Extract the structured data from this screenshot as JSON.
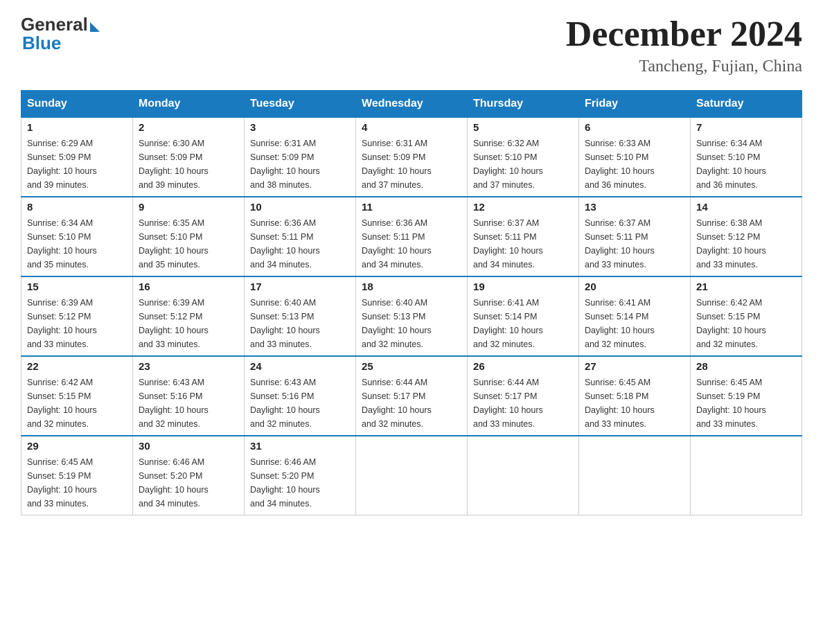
{
  "logo": {
    "general": "General",
    "blue": "Blue"
  },
  "header": {
    "month": "December 2024",
    "location": "Tancheng, Fujian, China"
  },
  "weekdays": [
    "Sunday",
    "Monday",
    "Tuesday",
    "Wednesday",
    "Thursday",
    "Friday",
    "Saturday"
  ],
  "weeks": [
    [
      {
        "day": "1",
        "sunrise": "6:29 AM",
        "sunset": "5:09 PM",
        "daylight": "10 hours and 39 minutes."
      },
      {
        "day": "2",
        "sunrise": "6:30 AM",
        "sunset": "5:09 PM",
        "daylight": "10 hours and 39 minutes."
      },
      {
        "day": "3",
        "sunrise": "6:31 AM",
        "sunset": "5:09 PM",
        "daylight": "10 hours and 38 minutes."
      },
      {
        "day": "4",
        "sunrise": "6:31 AM",
        "sunset": "5:09 PM",
        "daylight": "10 hours and 37 minutes."
      },
      {
        "day": "5",
        "sunrise": "6:32 AM",
        "sunset": "5:10 PM",
        "daylight": "10 hours and 37 minutes."
      },
      {
        "day": "6",
        "sunrise": "6:33 AM",
        "sunset": "5:10 PM",
        "daylight": "10 hours and 36 minutes."
      },
      {
        "day": "7",
        "sunrise": "6:34 AM",
        "sunset": "5:10 PM",
        "daylight": "10 hours and 36 minutes."
      }
    ],
    [
      {
        "day": "8",
        "sunrise": "6:34 AM",
        "sunset": "5:10 PM",
        "daylight": "10 hours and 35 minutes."
      },
      {
        "day": "9",
        "sunrise": "6:35 AM",
        "sunset": "5:10 PM",
        "daylight": "10 hours and 35 minutes."
      },
      {
        "day": "10",
        "sunrise": "6:36 AM",
        "sunset": "5:11 PM",
        "daylight": "10 hours and 34 minutes."
      },
      {
        "day": "11",
        "sunrise": "6:36 AM",
        "sunset": "5:11 PM",
        "daylight": "10 hours and 34 minutes."
      },
      {
        "day": "12",
        "sunrise": "6:37 AM",
        "sunset": "5:11 PM",
        "daylight": "10 hours and 34 minutes."
      },
      {
        "day": "13",
        "sunrise": "6:37 AM",
        "sunset": "5:11 PM",
        "daylight": "10 hours and 33 minutes."
      },
      {
        "day": "14",
        "sunrise": "6:38 AM",
        "sunset": "5:12 PM",
        "daylight": "10 hours and 33 minutes."
      }
    ],
    [
      {
        "day": "15",
        "sunrise": "6:39 AM",
        "sunset": "5:12 PM",
        "daylight": "10 hours and 33 minutes."
      },
      {
        "day": "16",
        "sunrise": "6:39 AM",
        "sunset": "5:12 PM",
        "daylight": "10 hours and 33 minutes."
      },
      {
        "day": "17",
        "sunrise": "6:40 AM",
        "sunset": "5:13 PM",
        "daylight": "10 hours and 33 minutes."
      },
      {
        "day": "18",
        "sunrise": "6:40 AM",
        "sunset": "5:13 PM",
        "daylight": "10 hours and 32 minutes."
      },
      {
        "day": "19",
        "sunrise": "6:41 AM",
        "sunset": "5:14 PM",
        "daylight": "10 hours and 32 minutes."
      },
      {
        "day": "20",
        "sunrise": "6:41 AM",
        "sunset": "5:14 PM",
        "daylight": "10 hours and 32 minutes."
      },
      {
        "day": "21",
        "sunrise": "6:42 AM",
        "sunset": "5:15 PM",
        "daylight": "10 hours and 32 minutes."
      }
    ],
    [
      {
        "day": "22",
        "sunrise": "6:42 AM",
        "sunset": "5:15 PM",
        "daylight": "10 hours and 32 minutes."
      },
      {
        "day": "23",
        "sunrise": "6:43 AM",
        "sunset": "5:16 PM",
        "daylight": "10 hours and 32 minutes."
      },
      {
        "day": "24",
        "sunrise": "6:43 AM",
        "sunset": "5:16 PM",
        "daylight": "10 hours and 32 minutes."
      },
      {
        "day": "25",
        "sunrise": "6:44 AM",
        "sunset": "5:17 PM",
        "daylight": "10 hours and 32 minutes."
      },
      {
        "day": "26",
        "sunrise": "6:44 AM",
        "sunset": "5:17 PM",
        "daylight": "10 hours and 33 minutes."
      },
      {
        "day": "27",
        "sunrise": "6:45 AM",
        "sunset": "5:18 PM",
        "daylight": "10 hours and 33 minutes."
      },
      {
        "day": "28",
        "sunrise": "6:45 AM",
        "sunset": "5:19 PM",
        "daylight": "10 hours and 33 minutes."
      }
    ],
    [
      {
        "day": "29",
        "sunrise": "6:45 AM",
        "sunset": "5:19 PM",
        "daylight": "10 hours and 33 minutes."
      },
      {
        "day": "30",
        "sunrise": "6:46 AM",
        "sunset": "5:20 PM",
        "daylight": "10 hours and 34 minutes."
      },
      {
        "day": "31",
        "sunrise": "6:46 AM",
        "sunset": "5:20 PM",
        "daylight": "10 hours and 34 minutes."
      },
      null,
      null,
      null,
      null
    ]
  ],
  "labels": {
    "sunrise": "Sunrise:",
    "sunset": "Sunset:",
    "daylight": "Daylight:"
  }
}
